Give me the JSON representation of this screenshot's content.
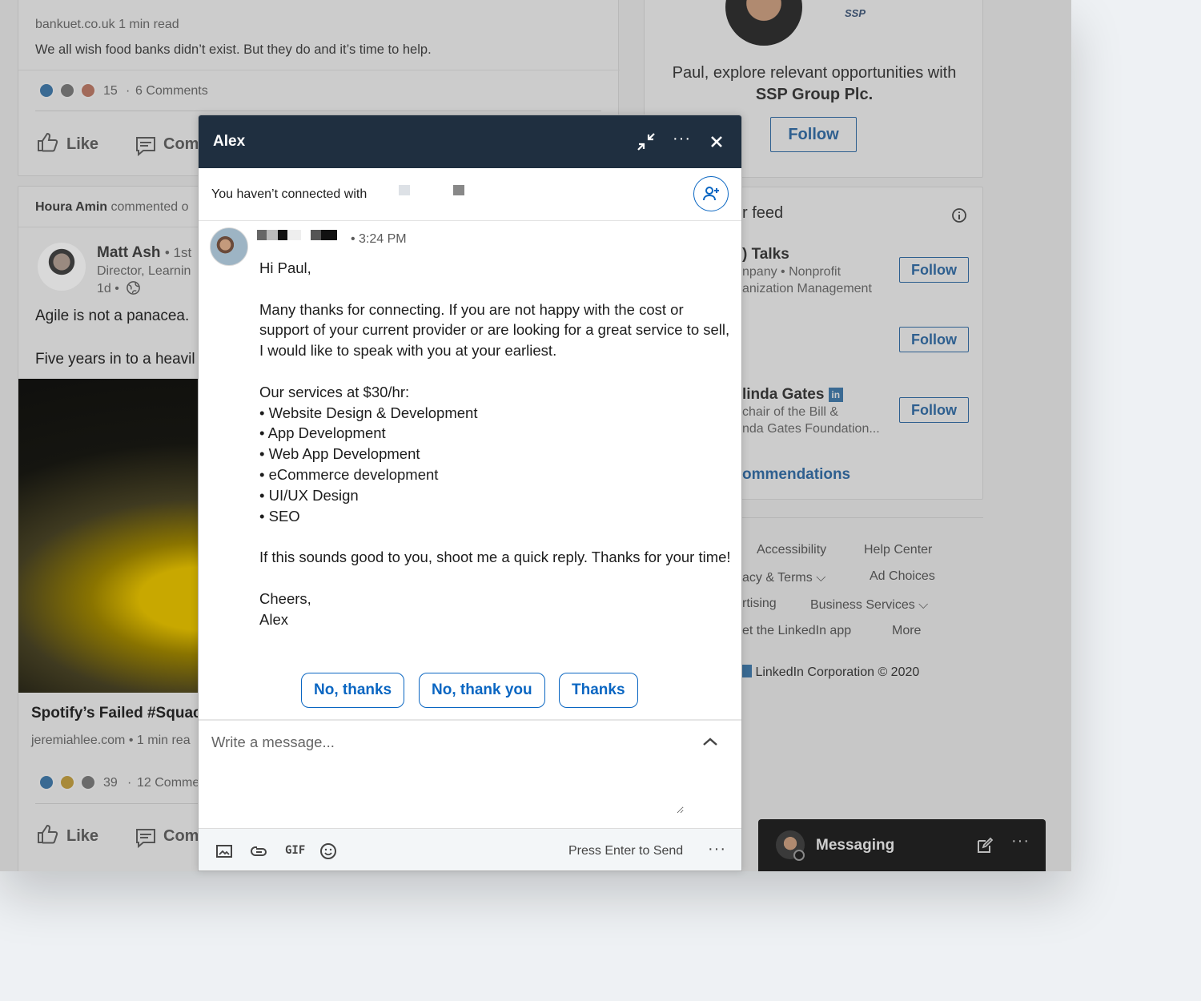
{
  "feed": {
    "post1": {
      "source": "bankuet.co.uk",
      "read_time": "1 min read",
      "description": "We all wish food banks didn’t exist. But they do and it’s time to help.",
      "reaction_count": "15",
      "comments": "6 Comments",
      "like_label": "Like",
      "comment_label": "Com"
    },
    "post2": {
      "activity_name": "Houra Amin",
      "activity_text": "commented o",
      "author": "Matt Ash",
      "degree": "• 1st",
      "headline": "Director, Learnin",
      "age": "1d •",
      "text1": "Agile is not a panacea.",
      "text2": "Five years in to a heavil",
      "article_title": "Spotify’s Failed #Squac",
      "article_source": "jeremiahlee.com",
      "article_read": "• 1 min rea",
      "reaction_count": "39",
      "comments": "12 Comme",
      "like_label": "Like",
      "comment_label": "Com"
    }
  },
  "rail": {
    "ad_text": "Paul, explore relevant opportunities with",
    "ad_company": "SSP Group Plc.",
    "ad_logo": "SSP",
    "ad_follow": "Follow",
    "feed_title": "r feed",
    "suggestions": [
      {
        "name": ") Talks",
        "sub1": "npany • Nonprofit",
        "sub2": "anization Management",
        "follow": "Follow"
      },
      {
        "name": "",
        "sub1": "(",
        "sub2": "",
        "follow": "Follow"
      },
      {
        "name": "linda Gates",
        "sub1": "chair of the Bill &",
        "sub2": "nda Gates Foundation...",
        "follow": "Follow"
      }
    ],
    "recommendations": "ommendations",
    "footer": {
      "accessibility": "Accessibility",
      "help_center": "Help Center",
      "privacy": "acy & Terms",
      "ad_choices": "Ad Choices",
      "advertising": "rtising",
      "business": "Business Services",
      "app": "et the LinkedIn app",
      "more": "More",
      "copyright": "LinkedIn Corporation © 2020"
    }
  },
  "chat": {
    "title": "Alex",
    "notice": "You haven’t connected with",
    "time": "• 3:24 PM",
    "message": "Hi Paul,\n\nMany thanks for connecting. If you are not happy with the cost or support of your current provider or are looking for a great service to sell, I would like to speak with you at your earliest.\n\nOur services at $30/hr:\n• Website Design & Development\n• App Development\n• Web App Development\n• eCommerce development\n• UI/UX Design\n• SEO\n\nIf this sounds good to you, shoot me a quick reply. Thanks for your time!\n\nCheers,\nAlex",
    "replies": [
      "No, thanks",
      "No, thank you",
      "Thanks"
    ],
    "placeholder": "Write a message...",
    "gif_label": "GIF",
    "send_hint": "Press Enter to Send"
  },
  "messaging_bar": {
    "label": "Messaging"
  },
  "colors": {
    "header": "#1f2f40",
    "accent": "#0a66c2"
  }
}
